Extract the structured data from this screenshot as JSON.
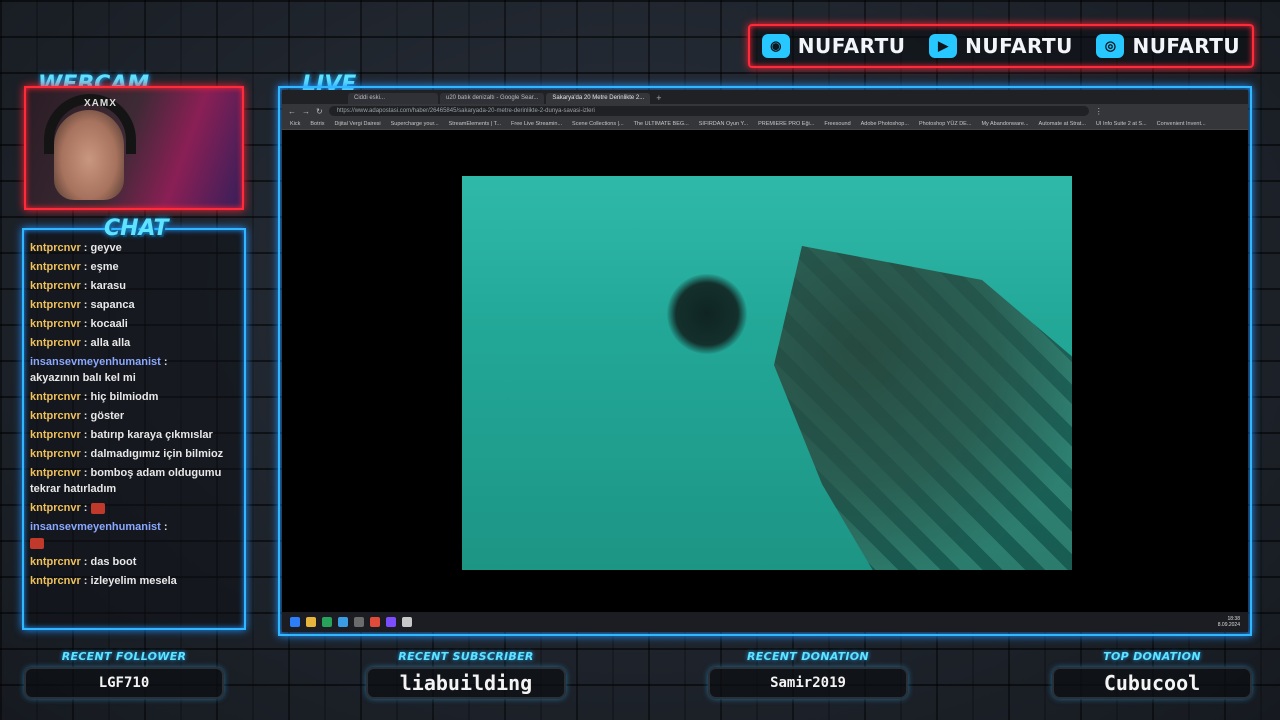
{
  "socials": [
    {
      "icon": "discord-icon",
      "glyph": "◉",
      "name": "NUFARTU"
    },
    {
      "icon": "youtube-icon",
      "glyph": "▶",
      "name": "NUFARTU"
    },
    {
      "icon": "instagram-icon",
      "glyph": "◎",
      "name": "NUFARTU"
    }
  ],
  "headings": {
    "webcam": "WEBCAM",
    "live": "LIVE",
    "chat": "CHAT"
  },
  "webcam": {
    "brand": "XAMX"
  },
  "chat": [
    {
      "user": "kntprcnvr",
      "msg": "geyve",
      "alt": false
    },
    {
      "user": "kntprcnvr",
      "msg": "eşme",
      "alt": false
    },
    {
      "user": "kntprcnvr",
      "msg": "karasu",
      "alt": false
    },
    {
      "user": "kntprcnvr",
      "msg": "sapanca",
      "alt": false
    },
    {
      "user": "kntprcnvr",
      "msg": "kocaali",
      "alt": false
    },
    {
      "user": "kntprcnvr",
      "msg": "alla alla",
      "alt": false
    },
    {
      "user": "insansevmeyenhumanist",
      "msg": "akyazının balı kel mi",
      "alt": true
    },
    {
      "user": "kntprcnvr",
      "msg": "hiç bilmiodm",
      "alt": false
    },
    {
      "user": "kntprcnvr",
      "msg": "göster",
      "alt": false
    },
    {
      "user": "kntprcnvr",
      "msg": "batırıp karaya çıkmıslar",
      "alt": false
    },
    {
      "user": "kntprcnvr",
      "msg": "dalmadıgımız için bilmioz",
      "alt": false
    },
    {
      "user": "kntprcnvr",
      "msg": "bomboş adam oldugumu tekrar hatırladım",
      "alt": false
    },
    {
      "user": "kntprcnvr",
      "msg": "",
      "alt": false,
      "emote": true
    },
    {
      "user": "insansevmeyenhumanist",
      "msg": "",
      "alt": true,
      "emote": true
    },
    {
      "user": "kntprcnvr",
      "msg": "das boot",
      "alt": false
    },
    {
      "user": "kntprcnvr",
      "msg": "izleyelim mesela",
      "alt": false
    }
  ],
  "browser": {
    "tabs": [
      "Ciddi eski...",
      "u20 batık denizaltı - Google Sear...",
      "Sakarya'da 20 Metre Derinlikte 2..."
    ],
    "active_tab": 2,
    "url": "https://www.adapostasi.com/haber/26465845/sakaryada-20-metre-derinlikte-2-dunya-savasi-izleri",
    "bookmarks": [
      "Kick",
      "Botrix",
      "Dijital Vergi Dairesi",
      "Supercharge your...",
      "StreamElements | T...",
      "Free Live Streamin...",
      "Scene Collections |...",
      "The ULTIMATE BEG...",
      "SIFIRDAN Oyun Y...",
      "PREMIERE PRO Eği...",
      "Freesound",
      "Adobe Photoshop...",
      "Photoshop YÜZ DE...",
      "My Abandonware...",
      "Automate at Strat...",
      "UI Info Suite 2 at S...",
      "Convenient Invent..."
    ],
    "clock": {
      "time": "18:38",
      "date": "8.09.2024"
    }
  },
  "stats": [
    {
      "title": "RECENT FOLLOWER",
      "value": "LGF710"
    },
    {
      "title": "RECENT SUBSCRIBER",
      "value": "liabuilding"
    },
    {
      "title": "RECENT DONATION",
      "value": "Samir2019"
    },
    {
      "title": "TOP DONATION",
      "value": "Cubucool"
    }
  ]
}
